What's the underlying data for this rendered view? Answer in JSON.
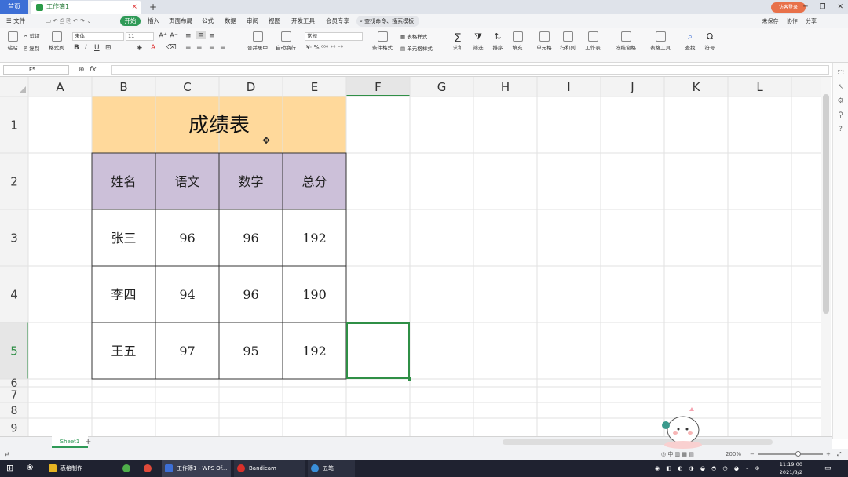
{
  "tabs": {
    "home": "首页",
    "doc": "工作簿1",
    "close": "×",
    "new": "+"
  },
  "user": {
    "badge": "访客登录"
  },
  "window": {
    "minimize": "─",
    "restore": "❐",
    "close": "✕"
  },
  "menu": {
    "file": "☰ 文件",
    "items": [
      "开始",
      "插入",
      "页面布局",
      "公式",
      "数据",
      "审阅",
      "视图",
      "开发工具",
      "会员专享"
    ],
    "search": "查找命令、搜索模板",
    "unsaved": "未保存",
    "collab": "协作",
    "share": "分享"
  },
  "ribbon": {
    "paste": "粘贴",
    "cut": "剪切",
    "copy": "复制",
    "format_painter": "格式刷",
    "font": "宋体",
    "font_size": "11",
    "number_format": "常规",
    "merge": "合并居中",
    "wrap": "自动换行",
    "cond_format": "条件格式",
    "table_style": "表格样式",
    "cell_style": "单元格样式",
    "sum": "求和",
    "filter": "筛选",
    "sort": "排序",
    "fill": "填充",
    "cell": "单元格",
    "row_col": "行和列",
    "worksheet": "工作表",
    "freeze": "冻结窗格",
    "table_tools": "表格工具",
    "find": "查找",
    "symbol": "符号"
  },
  "formula_bar": {
    "name_box": "F5",
    "fx": "fx",
    "value": ""
  },
  "grid": {
    "columns": [
      "A",
      "B",
      "C",
      "D",
      "E",
      "F",
      "G",
      "H",
      "I",
      "J",
      "K",
      "L"
    ],
    "rows": [
      "1",
      "2",
      "3",
      "4",
      "5",
      "6",
      "7",
      "8",
      "9"
    ],
    "active_cell": "F5",
    "title": "成绩表",
    "headers": [
      "姓名",
      "语文",
      "数学",
      "总分"
    ],
    "records": [
      [
        "张三",
        "96",
        "96",
        "192"
      ],
      [
        "李四",
        "94",
        "96",
        "190"
      ],
      [
        "王五",
        "97",
        "95",
        "192"
      ]
    ],
    "colors": {
      "title_fill": "#ffd99b",
      "header_fill": "#ccc0d9",
      "active_border": "#2f8f46",
      "grid_line": "#e2e2e2",
      "selected_header": "#e6e6e6"
    }
  },
  "sheets": {
    "tab": "Sheet1",
    "add": "+"
  },
  "status": {
    "zoom": "200%",
    "zoom_minus": "−",
    "zoom_plus": "+"
  },
  "taskbar": {
    "items": [
      "表格制作",
      "工作簿1 - WPS Of...",
      "Bandicam",
      "五笔"
    ],
    "time": "11:19:00",
    "date": "2021/8/2"
  }
}
